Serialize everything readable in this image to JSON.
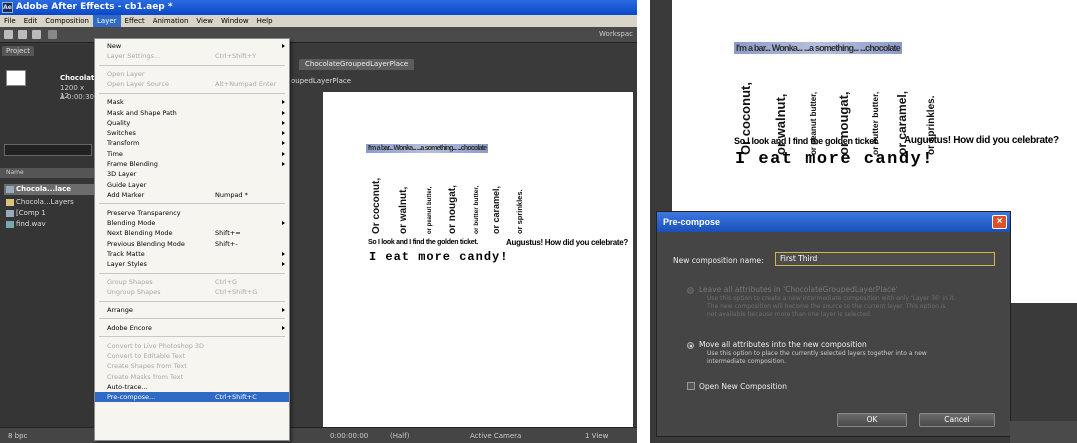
{
  "window": {
    "title": "Adobe After Effects - cb1.aep *",
    "app_icon": "Ae"
  },
  "menubar": [
    "File",
    "Edit",
    "Composition",
    "Layer",
    "Effect",
    "Animation",
    "View",
    "Window",
    "Help"
  ],
  "toolbar": {
    "workspace_label": "Workspac"
  },
  "project_panel": {
    "tab": "Project",
    "comp_name": "Chocolat",
    "comp_size": "1200 x 12",
    "comp_duration": "Δ 0:00:30",
    "column_header": "Name",
    "items": [
      "Chocola...lace",
      "Chocola...Layers",
      "[Comp 1",
      "find.wav"
    ],
    "bpc": "8 bpc"
  },
  "layer_menu": {
    "items": [
      {
        "label": "New",
        "shortcut": "",
        "submenu": true,
        "disabled": false
      },
      {
        "label": "Layer Settings...",
        "shortcut": "Ctrl+Shift+Y",
        "submenu": false,
        "disabled": true
      },
      {
        "label": "Open Layer",
        "shortcut": "",
        "submenu": false,
        "disabled": true
      },
      {
        "label": "Open Layer Source",
        "shortcut": "Alt+Numpad Enter",
        "submenu": false,
        "disabled": true
      },
      {
        "label": "Mask",
        "shortcut": "",
        "submenu": true,
        "disabled": false
      },
      {
        "label": "Mask and Shape Path",
        "shortcut": "",
        "submenu": true,
        "disabled": false
      },
      {
        "label": "Quality",
        "shortcut": "",
        "submenu": true,
        "disabled": false
      },
      {
        "label": "Switches",
        "shortcut": "",
        "submenu": true,
        "disabled": false
      },
      {
        "label": "Transform",
        "shortcut": "",
        "submenu": true,
        "disabled": false
      },
      {
        "label": "Time",
        "shortcut": "",
        "submenu": true,
        "disabled": false
      },
      {
        "label": "Frame Blending",
        "shortcut": "",
        "submenu": true,
        "disabled": false
      },
      {
        "label": "3D Layer",
        "shortcut": "",
        "submenu": false,
        "disabled": false
      },
      {
        "label": "Guide Layer",
        "shortcut": "",
        "submenu": false,
        "disabled": false
      },
      {
        "label": "Add Marker",
        "shortcut": "Numpad *",
        "submenu": false,
        "disabled": false
      },
      {
        "label": "Preserve Transparency",
        "shortcut": "",
        "submenu": false,
        "disabled": false
      },
      {
        "label": "Blending Mode",
        "shortcut": "",
        "submenu": true,
        "disabled": false
      },
      {
        "label": "Next Blending Mode",
        "shortcut": "Shift+=",
        "submenu": false,
        "disabled": false
      },
      {
        "label": "Previous Blending Mode",
        "shortcut": "Shift+-",
        "submenu": false,
        "disabled": false
      },
      {
        "label": "Track Matte",
        "shortcut": "",
        "submenu": true,
        "disabled": false
      },
      {
        "label": "Layer Styles",
        "shortcut": "",
        "submenu": true,
        "disabled": false
      },
      {
        "label": "Group Shapes",
        "shortcut": "Ctrl+G",
        "submenu": false,
        "disabled": true
      },
      {
        "label": "Ungroup Shapes",
        "shortcut": "Ctrl+Shift+G",
        "submenu": false,
        "disabled": true
      },
      {
        "label": "Arrange",
        "shortcut": "",
        "submenu": true,
        "disabled": false
      },
      {
        "label": "Adobe Encore",
        "shortcut": "",
        "submenu": true,
        "disabled": false
      },
      {
        "label": "Convert to Live Photoshop 3D",
        "shortcut": "",
        "submenu": false,
        "disabled": true
      },
      {
        "label": "Convert to Editable Text",
        "shortcut": "",
        "submenu": false,
        "disabled": true
      },
      {
        "label": "Create Shapes from Text",
        "shortcut": "",
        "submenu": false,
        "disabled": true
      },
      {
        "label": "Create Masks from Text",
        "shortcut": "",
        "submenu": false,
        "disabled": true
      },
      {
        "label": "Auto-trace...",
        "shortcut": "",
        "submenu": false,
        "disabled": false
      },
      {
        "label": "Pre-compose...",
        "shortcut": "Ctrl+Shift+C",
        "submenu": false,
        "disabled": false,
        "highlighted": true
      }
    ]
  },
  "composition_panel": {
    "tab": "ChocolateGroupedLayerPlace",
    "sub_tab": "oupedLayerPlace",
    "timecode": "0:00:00:00",
    "resolution": "(Half)",
    "camera": "Active Camera",
    "view": "1 View"
  },
  "canvas_text": {
    "banner": "I'm a bar... Wonka... ...a something... ...chocolate",
    "vertical": [
      "Or coconut,",
      "or walnut,",
      "or peanut butter,",
      "or nougat,",
      "or butter butter,",
      "or caramel,",
      "or sprinkles."
    ],
    "line1_a": "So I look and I find the golden ticket.",
    "line1_b": "Augustus! How did you celebrate?",
    "line2": "I eat more candy!"
  },
  "dialog": {
    "title": "Pre-compose",
    "name_label": "New composition name:",
    "name_value": "First Third",
    "option1": "Leave all attributes in 'ChocolateGroupedLayerPlace'",
    "option1_desc": "Use this option to create a new intermediate composition with only 'Layer 36' in it. The new composition will become the source to the current layer. This option is not available because more than one layer is selected.",
    "option2": "Move all attributes into the new composition",
    "option2_desc": "Use this option to place the currently selected layers together into a new intermediate composition.",
    "open_new": "Open New Composition",
    "ok": "OK",
    "cancel": "Cancel"
  }
}
